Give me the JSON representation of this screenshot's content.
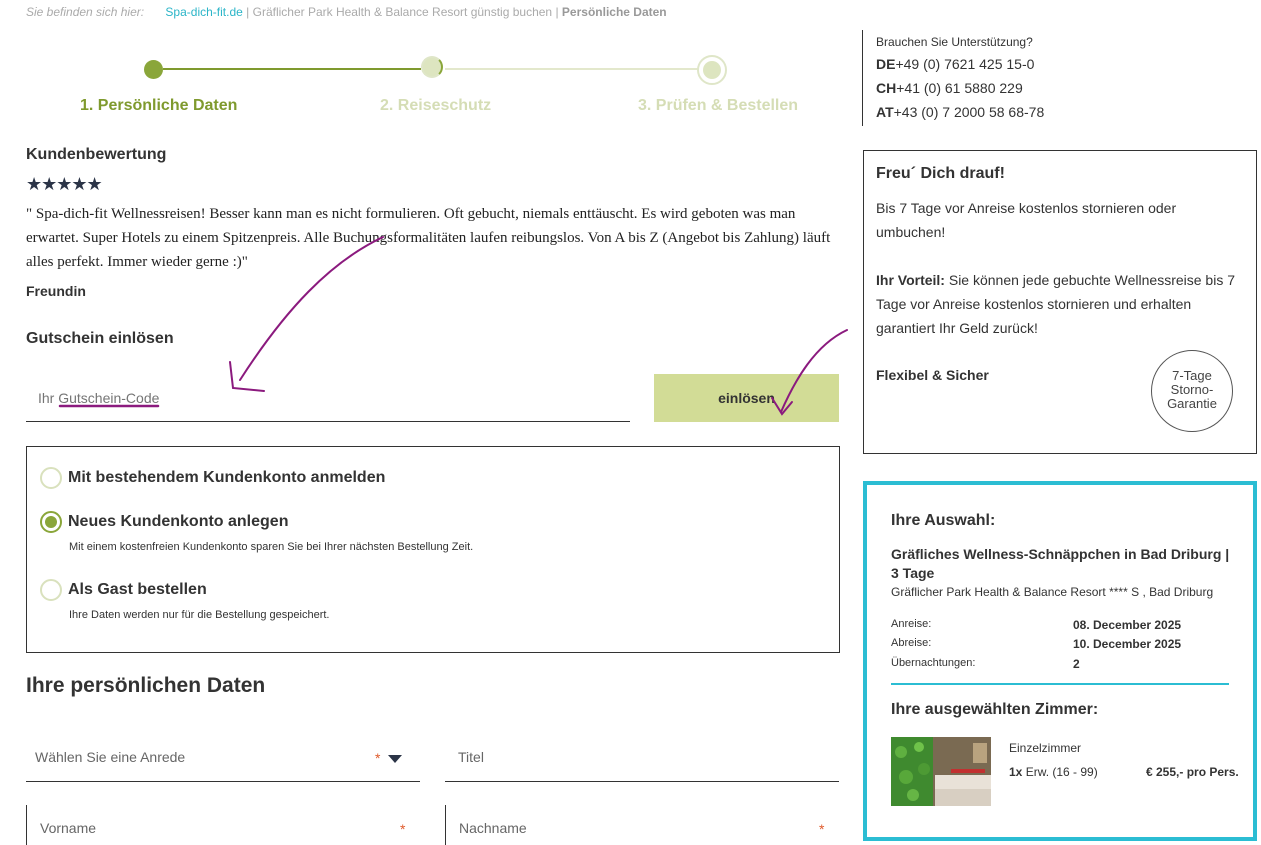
{
  "breadcrumb": {
    "intro": "Sie befinden sich hier:",
    "home": "Spa-dich-fit.de",
    "separator": "|",
    "middle": "Gräflicher Park Health & Balance Resort günstig buchen",
    "current": "Persönliche Daten"
  },
  "steps": [
    {
      "label": "1. Persönliche Daten"
    },
    {
      "label": "2. Reiseschutz"
    },
    {
      "label": "3. Prüfen & Bestellen"
    }
  ],
  "support": {
    "question": "Brauchen Sie Unterstützung?",
    "lines": [
      {
        "country": "DE",
        "phone": "+49 (0) 7621 425 15-0"
      },
      {
        "country": "CH",
        "phone": "+41 (0) 61 5880 229"
      },
      {
        "country": "AT",
        "phone": "+43 (0) 7 2000 58 68-78"
      }
    ]
  },
  "review": {
    "heading": "Kundenbewertung",
    "stars": "★★★★★",
    "text": "\" Spa-dich-fit Wellnessreisen! Besser kann man es nicht formulieren. Oft gebucht, niemals enttäuscht. Es wird geboten was man erwartet. Super Hotels zu einem Spitzenpreis. Alle Buchungsformalitäten laufen reibungslos. Von A bis Z (Angebot bis Zahlung) läuft alles perfekt. Immer wieder gerne :)\"",
    "author": "Freundin"
  },
  "voucher": {
    "heading": "Gutschein einlösen",
    "placeholder": "Ihr Gutschein-Code",
    "button": "einlösen"
  },
  "account": {
    "options": [
      {
        "label": "Mit bestehendem Kundenkonto anmelden",
        "hint": "",
        "checked": false
      },
      {
        "label": "Neues Kundenkonto anlegen",
        "hint": "Mit einem kostenfreien Kundenkonto sparen Sie bei Ihrer nächsten Bestellung Zeit.",
        "checked": true
      },
      {
        "label": "Als Gast bestellen",
        "hint": "Ihre Daten werden nur für die Bestellung gespeichert.",
        "checked": false
      }
    ]
  },
  "personal": {
    "heading": "Ihre persönlichen Daten",
    "fields": {
      "salutation": "Wählen Sie eine Anrede",
      "title": "Titel",
      "firstname": "Vorname",
      "lastname": "Nachname",
      "required_mark": "*"
    }
  },
  "storno": {
    "heading": "Freu´ Dich drauf!",
    "text1": "Bis 7 Tage vor Anreise kostenlos stornieren oder umbuchen!",
    "advantage_label": "Ihr Vorteil:",
    "advantage_text": " Sie können jede gebuchte Wellnessreise bis 7 Tage vor Anreise kostenlos stornieren und erhalten garantiert Ihr Geld zurück!",
    "flex": "Flexibel & Sicher",
    "badge_line1": "7-Tage",
    "badge_line2": "Storno-",
    "badge_line3": "Garantie"
  },
  "selection": {
    "heading": "Ihre Auswahl:",
    "package": "Gräfliches Wellness-Schnäppchen in Bad Driburg | 3 Tage",
    "hotel": "Gräflicher Park Health & Balance Resort **** S , Bad Driburg",
    "arrival_label": "Anreise:",
    "arrival": "08. December 2025",
    "departure_label": "Abreise:",
    "departure": "10. December 2025",
    "nights_label": "Übernachtungen:",
    "nights": "2",
    "rooms_heading": "Ihre ausgewählten Zimmer:",
    "room_type": "Einzelzimmer",
    "room_qty": "1x",
    "room_guests": " Erw. (16 - 99)",
    "room_price": "€ 255,- pro Pers."
  },
  "colors": {
    "accent_green": "#8aa63a",
    "light_green": "#d2dc96",
    "teal": "#2bbdd3",
    "annotation": "#8b1a7e"
  }
}
